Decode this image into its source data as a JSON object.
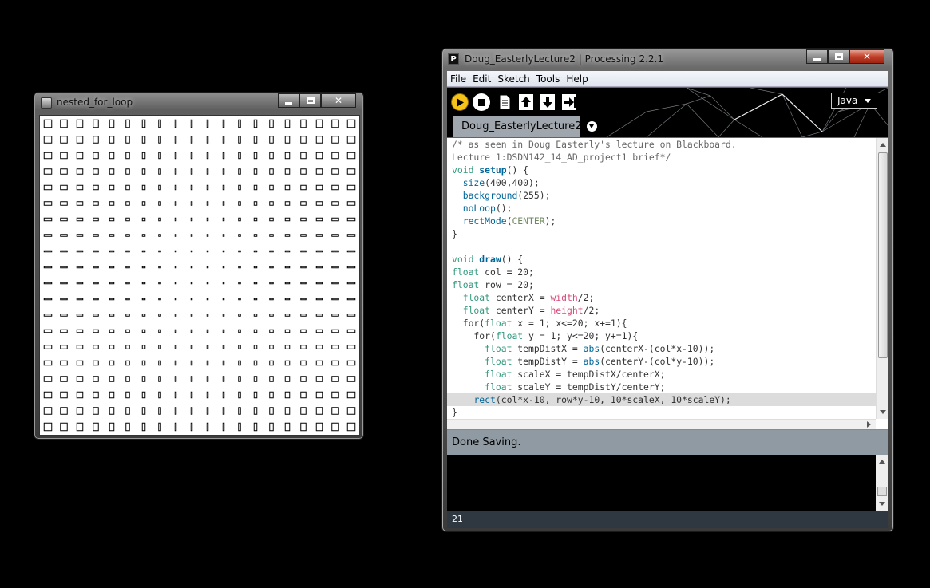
{
  "sketch_window": {
    "title": "nested_for_loop",
    "grid": {
      "cols": 20,
      "rows": 20,
      "col": 20,
      "row": 20,
      "canvas_size": 400
    }
  },
  "ide_window": {
    "title": "Doug_EasterlyLecture2 | Processing 2.2.1",
    "logo": "P",
    "menu": [
      "File",
      "Edit",
      "Sketch",
      "Tools",
      "Help"
    ],
    "toolbar": {
      "buttons": [
        "run-icon",
        "stop-icon",
        "new-icon",
        "open-icon",
        "save-icon",
        "export-icon"
      ],
      "mode": "Java"
    },
    "tab": {
      "label": "Doug_EasterlyLecture2"
    },
    "code_lines": [
      "/* as seen in Doug Easterly's lecture on Blackboard.",
      "Lecture 1:DSDN142_14_AD_project1 brief*/",
      "void setup() {",
      "  size(400,400);",
      "  background(255);",
      "  noLoop();",
      "  rectMode(CENTER);",
      "}",
      "",
      "void draw() {",
      "float col = 20;",
      "float row = 20;",
      "  float centerX = width/2;",
      "  float centerY = height/2;",
      "  for(float x = 1; x<=20; x+=1){",
      "    for(float y = 1; y<=20; y+=1){",
      "      float tempDistX = abs(centerX-(col*x-10));",
      "      float tempDistY = abs(centerY-(col*y-10));",
      "      float scaleX = tempDistX/centerX;",
      "      float scaleY = tempDistY/centerY;",
      "    rect(col*x-10, row*y-10, 10*scaleX, 10*scaleY);",
      "}"
    ],
    "highlighted_line": 20,
    "status": "Done Saving.",
    "line_number": "21"
  }
}
